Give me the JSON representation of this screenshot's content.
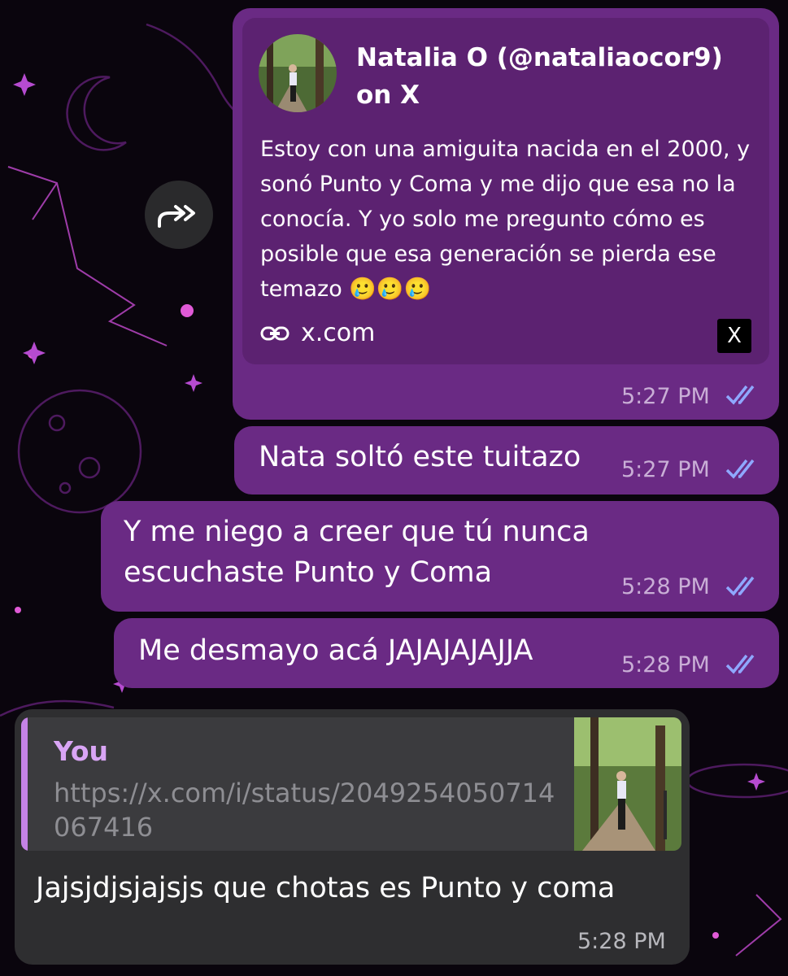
{
  "colors": {
    "outgoing_bubble": "#6a2a84",
    "link_preview_bg": "#5c2271",
    "incoming_bubble": "#2e2e30",
    "quote_accent": "#c583e6",
    "read_checks": "#8fa8ff"
  },
  "forward_button": {
    "icon": "forward-arrows-icon"
  },
  "link_preview_message": {
    "preview": {
      "title": "Natalia O (@nataliaocor9) on X",
      "description": "Estoy con una amiguita nacida en el 2000, y sonó Punto y Coma y me dijo que esa no la conocía. Y yo solo me pregunto cómo es posible que esa generación se pierda ese temazo 🥲🥲🥲",
      "link_icon": "link-icon",
      "domain": "x.com",
      "source_logo": "X"
    },
    "time": "5:27 PM",
    "status_icon": "double-check-icon"
  },
  "messages": [
    {
      "text": "Nata soltó este tuitazo",
      "time": "5:27 PM"
    },
    {
      "lines": [
        "Y me niego a creer que tú nunca",
        "escuchaste Punto y Coma"
      ],
      "time": "5:28 PM"
    },
    {
      "text": "Me desmayo acá JAJAJAJAJJA",
      "time": "5:28 PM"
    }
  ],
  "reply_message": {
    "quote": {
      "author": "You",
      "text": "https://x.com/i/status/2049254050714067416"
    },
    "text": "Jajsjdjsjajsjs que chotas es Punto y coma",
    "time": "5:28 PM"
  }
}
